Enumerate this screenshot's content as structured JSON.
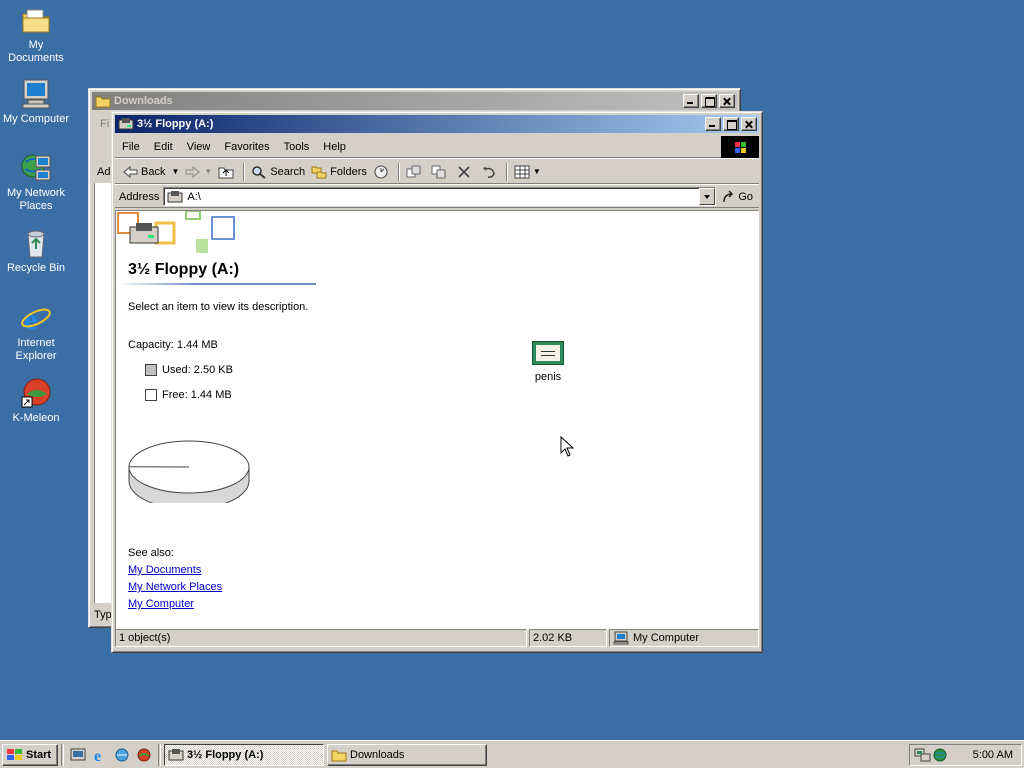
{
  "desktop": {
    "icons": [
      {
        "label": "My Documents",
        "icon": "folder-documents-icon"
      },
      {
        "label": "My Computer",
        "icon": "computer-icon"
      },
      {
        "label_line1": "My Network",
        "label_line2": "Places",
        "icon": "network-places-icon"
      },
      {
        "label": "Recycle Bin",
        "icon": "recycle-bin-icon"
      },
      {
        "label_line1": "Internet",
        "label_line2": "Explorer",
        "icon": "internet-explorer-icon"
      },
      {
        "label": "K-Meleon",
        "icon": "k-meleon-icon"
      }
    ]
  },
  "back_window": {
    "title": "Downloads",
    "peek_texts": [
      "Fi",
      "Ad",
      "Typ"
    ]
  },
  "explorer": {
    "title": "3½ Floppy (A:)",
    "menu": [
      "File",
      "Edit",
      "View",
      "Favorites",
      "Tools",
      "Help"
    ],
    "toolbar": {
      "back": "Back",
      "search": "Search",
      "folders": "Folders"
    },
    "address": {
      "label": "Address",
      "value": "A:\\",
      "go": "Go"
    },
    "webview": {
      "heading": "3½ Floppy (A:)",
      "prompt": "Select an item to view its description.",
      "capacity": "Capacity: 1.44 MB",
      "used": "Used: 2.50 KB",
      "free": "Free: 1.44 MB",
      "used_fraction": 0.0017,
      "see_also": "See also:",
      "links": [
        "My Documents",
        "My Network Places",
        "My Computer"
      ]
    },
    "files": [
      {
        "name": "penis",
        "icon": "certificate-file-icon"
      }
    ],
    "status": {
      "objects": "1 object(s)",
      "size": "2.02 KB",
      "zone": "My Computer"
    }
  },
  "taskbar": {
    "start": "Start",
    "tasks": [
      {
        "label": "3½ Floppy (A:)",
        "active": true
      },
      {
        "label": "Downloads",
        "active": false
      }
    ],
    "clock": "5:00 AM"
  },
  "colors": {
    "desktop": "#3a6ea5",
    "active_title_start": "#0a246a",
    "active_title_end": "#a6caf0",
    "face": "#d4d0c8",
    "link": "#0000cc"
  }
}
